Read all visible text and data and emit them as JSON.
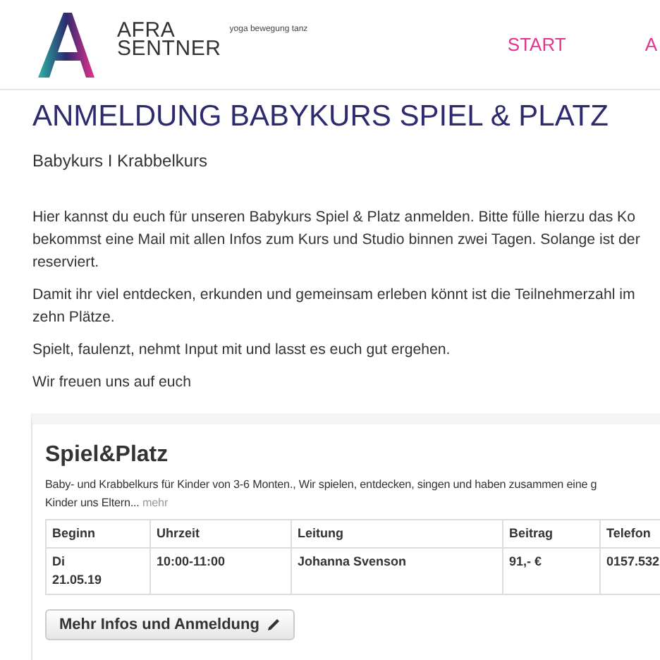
{
  "header": {
    "brand_line1": "AFRA",
    "brand_line2": "SENTNER",
    "tagline": "yoga bewegung tanz",
    "nav": [
      {
        "label": "START"
      },
      {
        "label": "A"
      }
    ]
  },
  "title": "ANMELDUNG BABYKURS SPIEL & PLATZ",
  "subtitle": "Babykurs I Krabbelkurs",
  "paragraphs": [
    [
      "Hier kannst du euch für unseren Babykurs Spiel & Platz anmelden. Bitte fülle hierzu das Ko",
      "bekommst eine Mail mit allen Infos zum Kurs und Studio binnen zwei Tagen. Solange ist der",
      "reserviert."
    ],
    [
      "Damit ihr viel entdecken, erkunden und gemeinsam erleben könnt ist die Teilnehmerzahl im",
      "zehn Plätze."
    ],
    [
      "Spielt, faulenzt, nehmt Input mit und lasst es euch gut ergehen."
    ],
    [
      "Wir freuen uns auf euch"
    ]
  ],
  "course": {
    "name": "Spiel&Platz",
    "description": [
      "Baby- und Krabbelkurs für Kinder von 3-6 Monten., Wir spielen, entdecken, singen und haben zusammen eine g",
      "Kinder uns Eltern..."
    ],
    "more_link": "mehr",
    "table": {
      "columns": [
        "Beginn",
        "Uhrzeit",
        "Leitung",
        "Beitrag",
        "Telefon"
      ],
      "rows": [
        [
          [
            "Di",
            "21.05.19"
          ],
          [
            "10:00-11:00"
          ],
          [
            "Johanna Svenson"
          ],
          [
            "91,- €"
          ],
          [
            "0157.532"
          ]
        ]
      ]
    },
    "button": "Mehr Infos und Anmeldung"
  }
}
